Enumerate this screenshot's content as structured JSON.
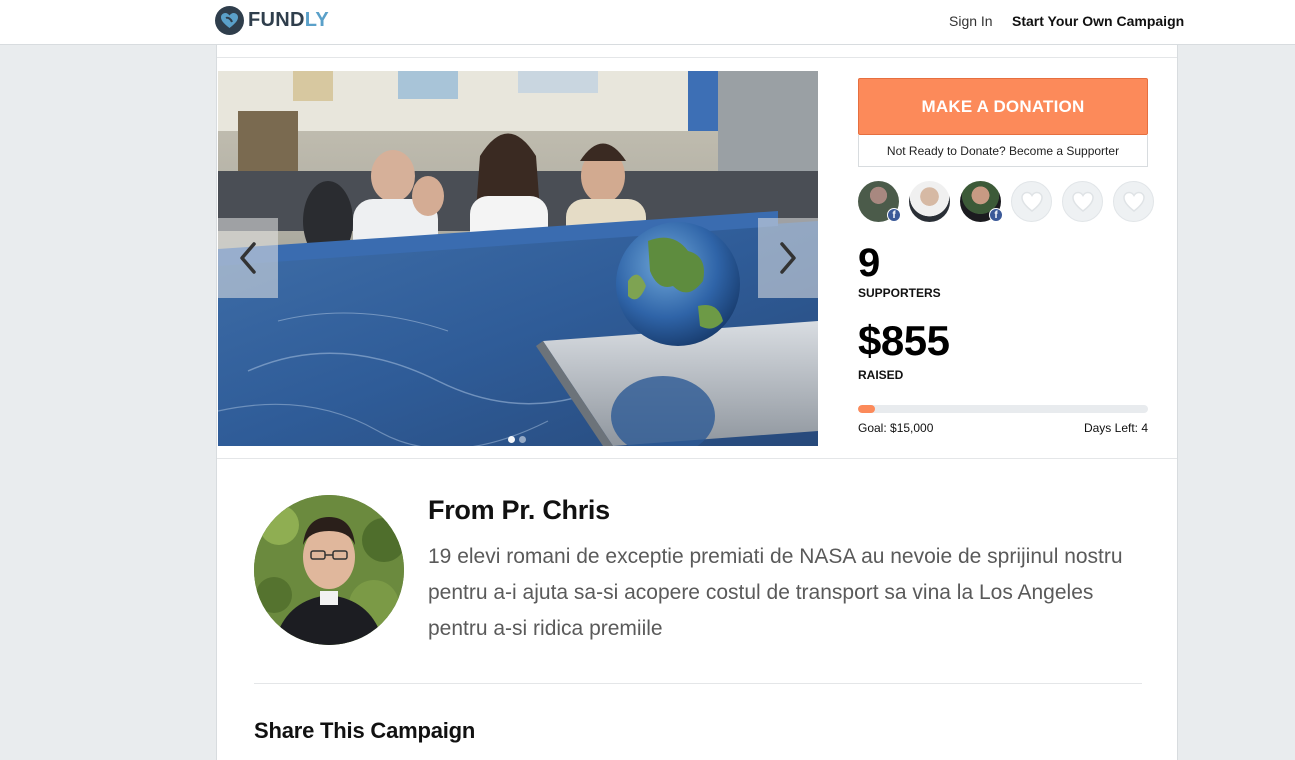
{
  "brand": {
    "name_main": "FUND",
    "name_accent": "LY",
    "accent_color": "#5aa0c9",
    "dark_color": "#2f3e4c"
  },
  "nav": {
    "sign_in": "Sign In",
    "start_campaign": "Start Your Own Campaign"
  },
  "hero": {
    "prev_icon": "chevron-left-icon",
    "next_icon": "chevron-right-icon",
    "slide_count": 2,
    "active_slide": 1
  },
  "sidebar": {
    "donate_label": "MAKE A DONATION",
    "donate_color": "#fc8a5a",
    "supporter_label": "Not Ready to Donate? Become a Supporter",
    "avatars": [
      {
        "kind": "photo",
        "facebook": true
      },
      {
        "kind": "photo",
        "facebook": false
      },
      {
        "kind": "photo",
        "facebook": true
      },
      {
        "kind": "empty"
      },
      {
        "kind": "empty"
      },
      {
        "kind": "empty"
      }
    ],
    "supporters_count": "9",
    "supporters_label": "SUPPORTERS",
    "raised_amount": "$855",
    "raised_label": "RAISED",
    "progress_fraction": 0.057,
    "goal_text": "Goal: $15,000",
    "days_left_text": "Days Left: 4"
  },
  "creator": {
    "title": "From Pr. Chris",
    "description": "19 elevi romani de exceptie premiati de NASA au nevoie de sprijinul nostru pentru a-i ajuta sa-si acopere costul de transport sa vina la Los Angeles pentru a-si ridica premiile"
  },
  "share": {
    "title": "Share This Campaign"
  }
}
